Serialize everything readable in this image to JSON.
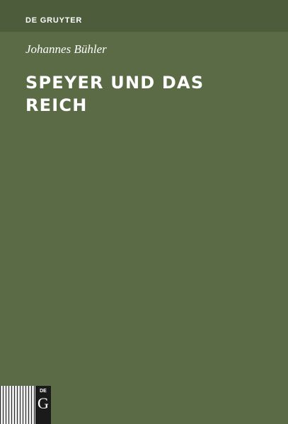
{
  "cover": {
    "publisher": "DE GRUYTER",
    "author": "Johannes Bühler",
    "title_lines": [
      "SPEYER UND DAS",
      "REICH"
    ],
    "logo": {
      "top_text": "DE",
      "letter": "G"
    },
    "colors": {
      "background": "#5a6b46",
      "top_band": "#4d5d3b",
      "text": "#ffffff",
      "logo_box": "#1a1a1a"
    }
  }
}
